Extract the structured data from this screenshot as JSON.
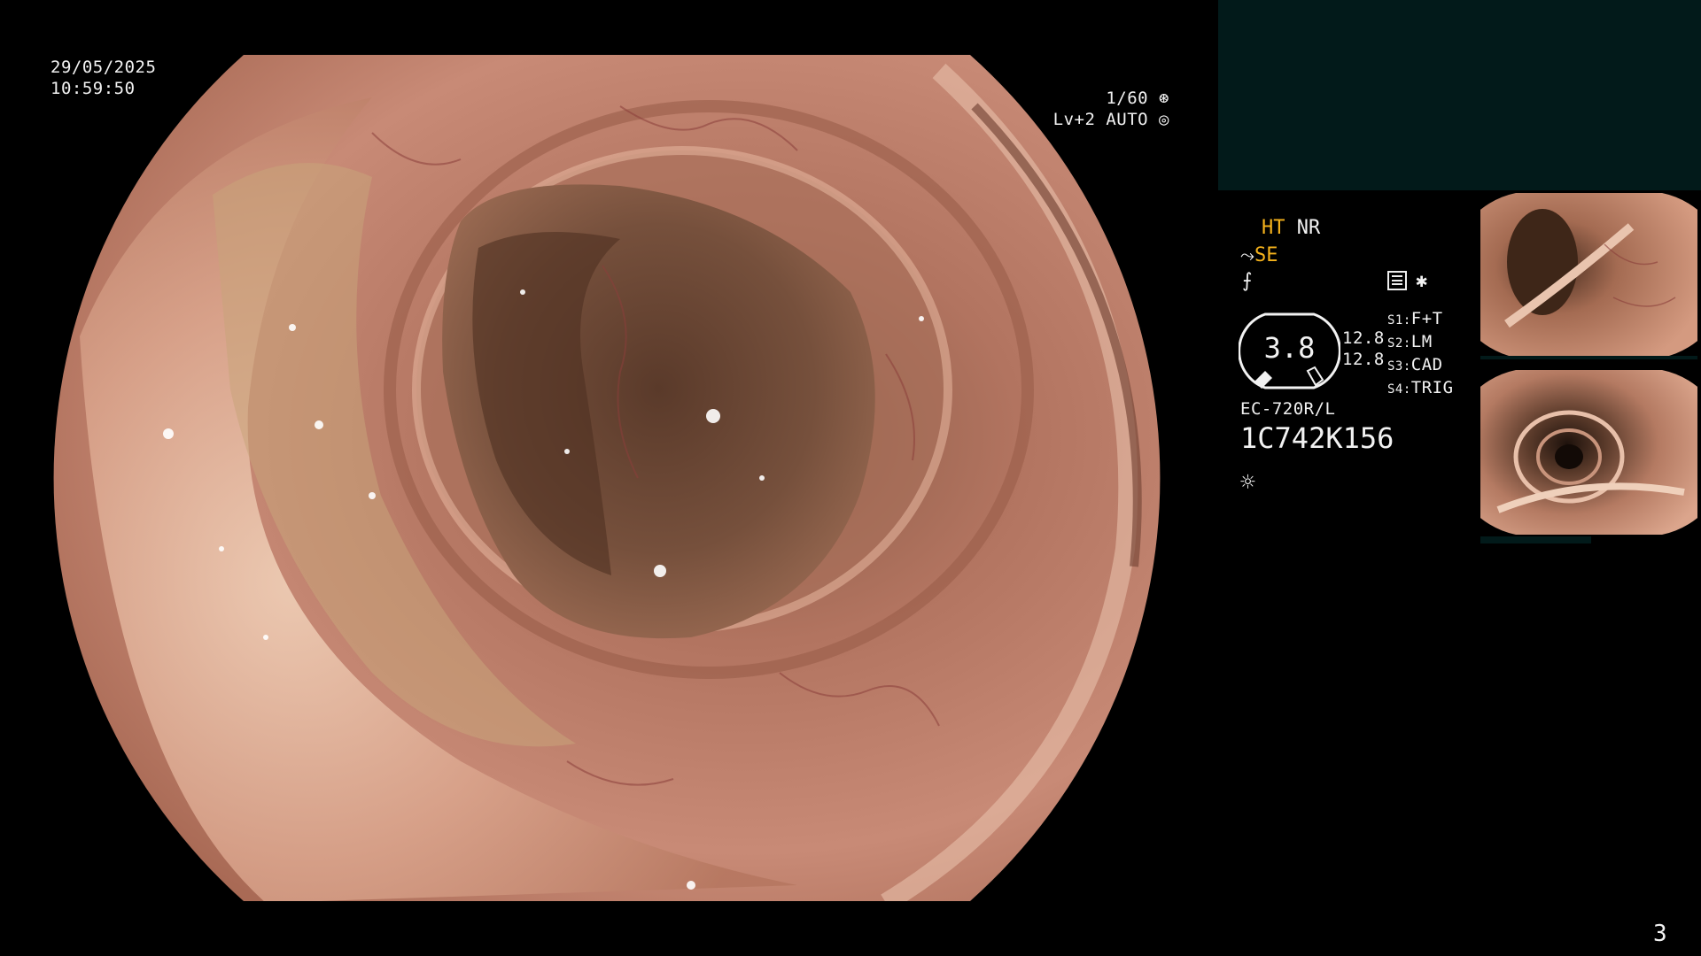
{
  "osd": {
    "date": "29/05/2025",
    "time": "10:59:50",
    "shutter": "1/60",
    "level": "Lv+2 AUTO"
  },
  "modes": {
    "ht": "HT",
    "nr": "NR",
    "se": "SE"
  },
  "gauge": {
    "value": "3.8",
    "pressure_top": "12.8",
    "pressure_bottom": "12.8"
  },
  "switches": {
    "s1_label": "S1:",
    "s1_value": "F+T",
    "s2_label": "S2:",
    "s2_value": "LM",
    "s3_label": "S3:",
    "s3_value": "CAD",
    "s4_label": "S4:",
    "s4_value": "TRIG"
  },
  "scope_info": {
    "model": "EC-720R/L",
    "serial": "1C742K156"
  },
  "page_number": "3",
  "icons": [
    "shutter-icon",
    "auto-iris-icon",
    "scope-angle-icon",
    "flash-icon",
    "memory-icon",
    "asterisk-icon",
    "light-sun-icon"
  ],
  "colors": {
    "background": "#000000",
    "panel": "#021a1a",
    "mode_accent": "#f5b21c",
    "text": "#f2f2f2"
  }
}
